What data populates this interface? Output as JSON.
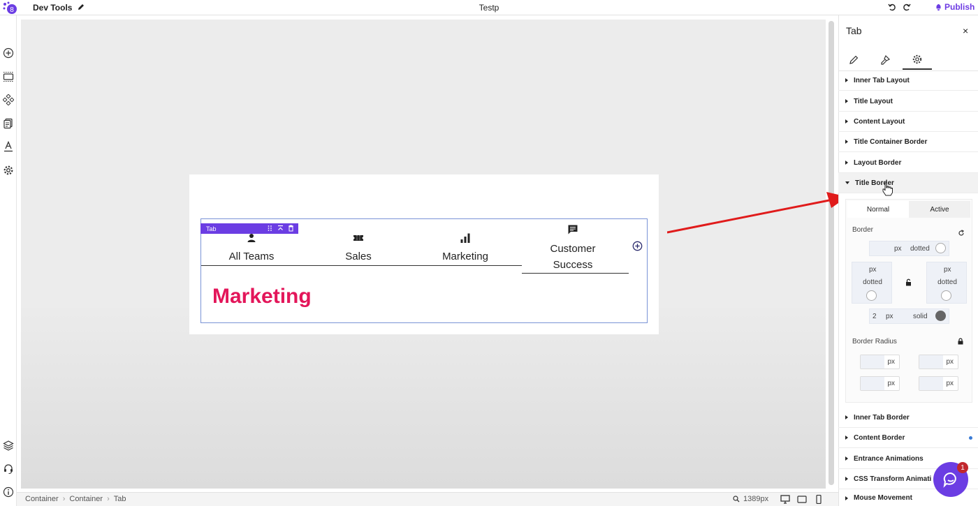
{
  "topbar": {
    "app_title": "Dev Tools",
    "page_title": "Testp",
    "publish_label": "Publish"
  },
  "logo_text": "8",
  "canvas": {
    "badge_label": "Tab",
    "tabs": [
      {
        "label": "All Teams",
        "icon": "person-icon"
      },
      {
        "label": "Sales",
        "icon": "ticket-icon"
      },
      {
        "label": "Marketing",
        "icon": "bar-chart-icon"
      },
      {
        "label": "Customer Success",
        "line1": "Customer",
        "line2": "Success",
        "icon": "chat-icon"
      }
    ],
    "active_tab_content": "Marketing"
  },
  "bottombar": {
    "breadcrumb": [
      "Container",
      "Container",
      "Tab"
    ],
    "zoom": "1389px"
  },
  "panel": {
    "title": "Tab",
    "close": "×",
    "sections_top": [
      "Inner Tab Layout",
      "Title Layout",
      "Content Layout",
      "Title Container Border",
      "Layout Border"
    ],
    "open_section": "Title Border",
    "state_tabs": {
      "normal": "Normal",
      "active": "Active"
    },
    "border_label": "Border",
    "border_top": {
      "unit": "px",
      "style": "dotted"
    },
    "border_left": {
      "unit": "px",
      "style": "dotted"
    },
    "border_right": {
      "unit": "px",
      "style": "dotted"
    },
    "border_bottom": {
      "value": "2",
      "unit": "px",
      "style": "solid"
    },
    "radius_label": "Border Radius",
    "radius_unit": "px",
    "sections_bottom": [
      "Inner Tab Border",
      "Content Border",
      "Entrance Animations",
      "CSS Transform Animati",
      "Mouse Movement"
    ]
  },
  "chat_badge": "1",
  "colors": {
    "accent": "#6b3de3",
    "content_text": "#e3165a",
    "arrow": "#e01b1b"
  }
}
